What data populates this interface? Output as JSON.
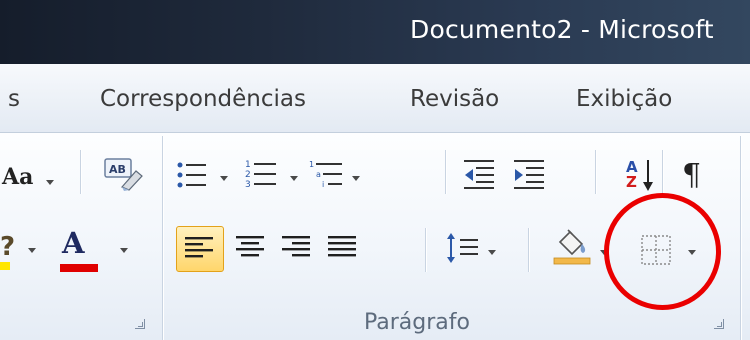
{
  "window": {
    "title": "Documento2 - Microsoft"
  },
  "tabs": [
    {
      "label": "s"
    },
    {
      "label": "Correspondências"
    },
    {
      "label": "Revisão"
    },
    {
      "label": "Exibição"
    }
  ],
  "groups": {
    "paragraph": {
      "label": "Parágrafo"
    }
  },
  "font_group": {
    "change_case_label": "Aa",
    "font_color_label": "A",
    "font_color": "#e00000",
    "highlight_color": "#ffe600"
  },
  "paragraph_group": {
    "show_marks_label": "¶",
    "sort_label_a": "A",
    "sort_label_z": "Z",
    "active_alignment": "align-left"
  },
  "annotation": {
    "shape": "circle",
    "color": "#ea0000",
    "target": "borders-button"
  },
  "icons": [
    "text-effects-icon",
    "bullets-icon",
    "numbering-icon",
    "multilevel-list-icon",
    "decrease-indent-icon",
    "increase-indent-icon",
    "sort-icon",
    "show-marks-icon",
    "align-left-icon",
    "center-icon",
    "align-right-icon",
    "justify-icon",
    "line-spacing-icon",
    "shading-icon",
    "borders-icon"
  ]
}
